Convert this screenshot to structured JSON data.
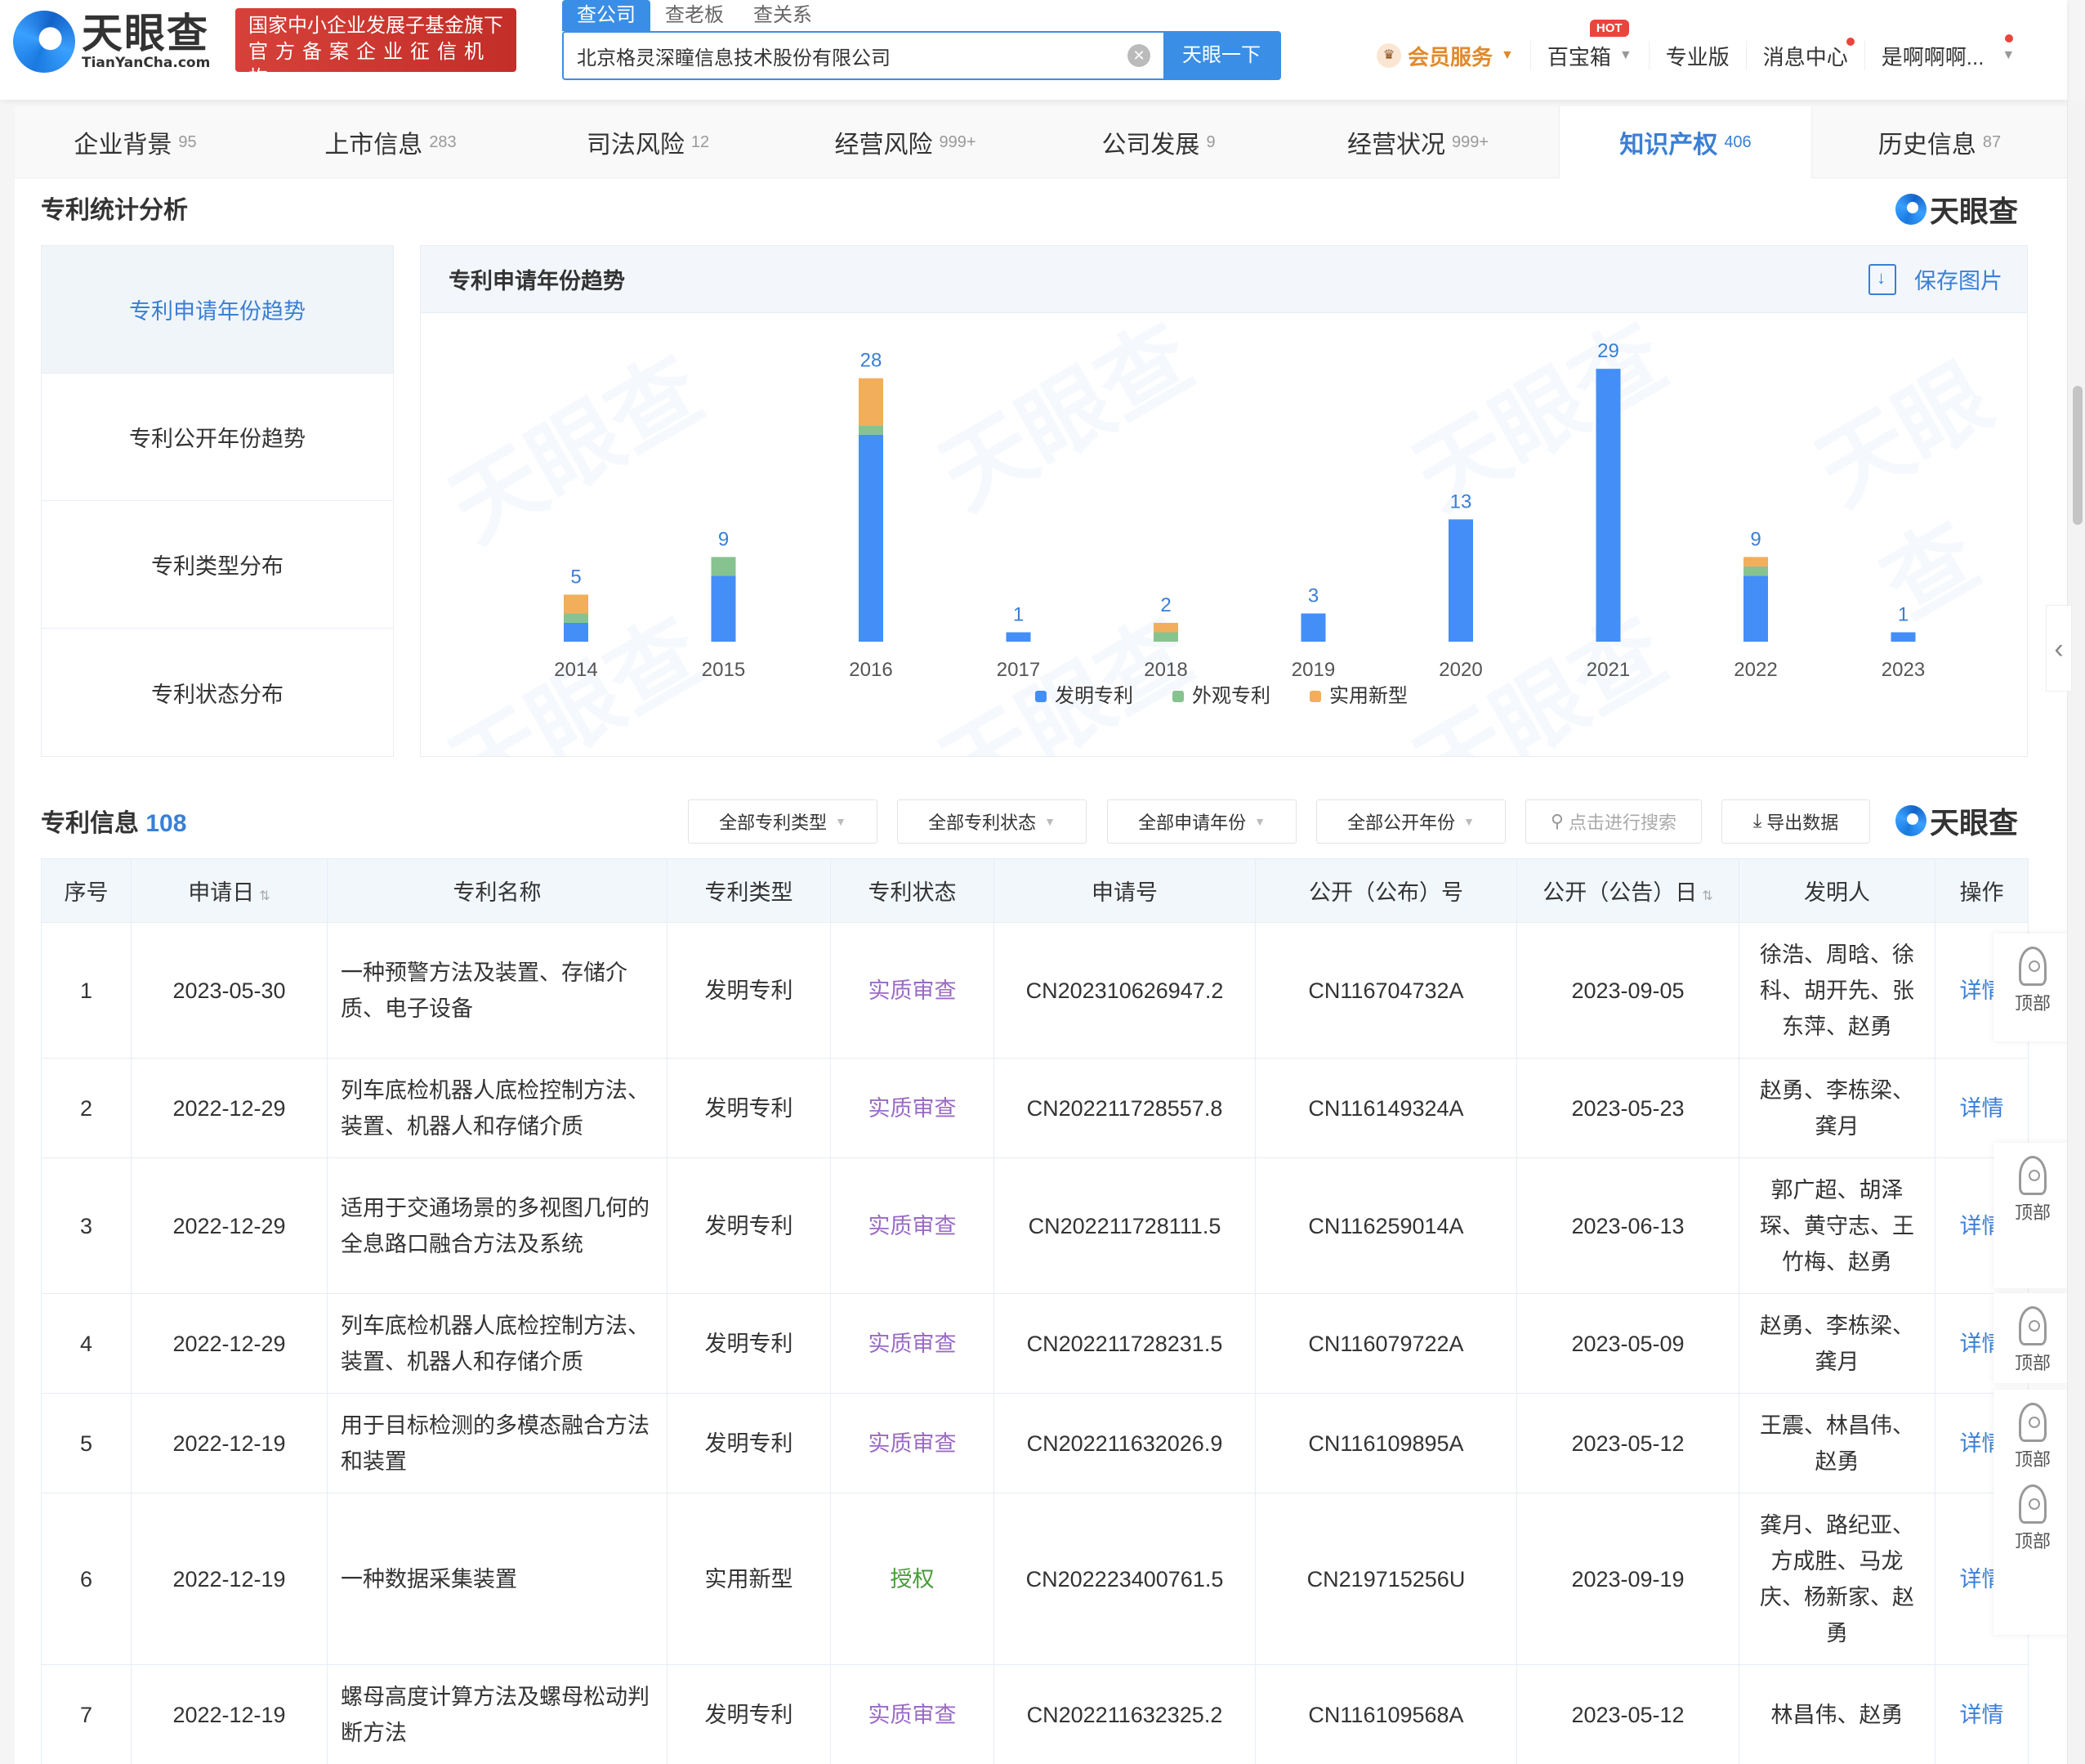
{
  "header": {
    "logo_cn": "天眼查",
    "logo_en": "TianYanCha.com",
    "badge_line1": "国家中小企业发展子基金旗下",
    "badge_line2": "官方备案企业征信机构",
    "search_tabs": [
      "查公司",
      "查老板",
      "查关系"
    ],
    "search_value": "北京格灵深瞳信息技术股份有限公司",
    "search_button": "天眼一下",
    "nav": {
      "vip": "会员服务",
      "toolbox": "百宝箱",
      "hot_badge": "HOT",
      "pro": "专业版",
      "messages": "消息中心",
      "user": "是啊啊啊..."
    }
  },
  "tabs": [
    {
      "label": "企业背景",
      "count": "95"
    },
    {
      "label": "上市信息",
      "count": "283"
    },
    {
      "label": "司法风险",
      "count": "12"
    },
    {
      "label": "经营风险",
      "count": "999+"
    },
    {
      "label": "公司发展",
      "count": "9"
    },
    {
      "label": "经营状况",
      "count": "999+"
    },
    {
      "label": "知识产权",
      "count": "406",
      "active": true
    },
    {
      "label": "历史信息",
      "count": "87"
    }
  ],
  "stats_section": {
    "title": "专利统计分析",
    "brand": "天眼查",
    "menu": [
      "专利申请年份趋势",
      "专利公开年份趋势",
      "专利类型分布",
      "专利状态分布"
    ],
    "active_menu": 0,
    "chart_title": "专利申请年份趋势",
    "save_label": "保存图片"
  },
  "chart_data": {
    "type": "bar",
    "stacked": true,
    "title": "专利申请年份趋势",
    "xlabel": "",
    "ylabel": "",
    "categories": [
      "2014",
      "2015",
      "2016",
      "2017",
      "2018",
      "2019",
      "2020",
      "2021",
      "2022",
      "2023"
    ],
    "series": [
      {
        "name": "发明专利",
        "color": "#448ef7",
        "values": [
          2,
          7,
          22,
          1,
          0,
          3,
          13,
          29,
          7,
          1
        ]
      },
      {
        "name": "外观专利",
        "color": "#87c38f",
        "values": [
          1,
          2,
          1,
          0,
          1,
          0,
          0,
          0,
          1,
          0
        ]
      },
      {
        "name": "实用新型",
        "color": "#f2ae5b",
        "values": [
          2,
          0,
          5,
          0,
          1,
          0,
          0,
          0,
          1,
          0
        ]
      }
    ],
    "totals": [
      5,
      9,
      28,
      1,
      2,
      3,
      13,
      29,
      9,
      1
    ],
    "ylim": [
      0,
      30
    ],
    "grid": false,
    "legend": "bottom-center"
  },
  "patent_section": {
    "title": "专利信息",
    "count": "108",
    "filters": [
      "全部专利类型",
      "全部专利状态",
      "全部申请年份",
      "全部公开年份"
    ],
    "search_placeholder": "点击进行搜索",
    "export_label": "导出数据",
    "brand": "天眼查"
  },
  "table": {
    "columns": [
      "序号",
      "申请日",
      "专利名称",
      "专利类型",
      "专利状态",
      "申请号",
      "公开（公布）号",
      "公开（公告）日",
      "发明人",
      "操作"
    ],
    "rows": [
      {
        "no": "1",
        "apply_date": "2023-05-30",
        "name": "一种预警方法及装置、存储介质、电子设备",
        "type": "发明专利",
        "status": "实质审查",
        "apply_no": "CN202310626947.2",
        "pub_no": "CN116704732A",
        "pub_date": "2023-09-05",
        "inventors": "徐浩、周晗、徐科、胡开先、张东萍、赵勇",
        "action": "详情"
      },
      {
        "no": "2",
        "apply_date": "2022-12-29",
        "name": "列车底检机器人底检控制方法、装置、机器人和存储介质",
        "type": "发明专利",
        "status": "实质审查",
        "apply_no": "CN202211728557.8",
        "pub_no": "CN116149324A",
        "pub_date": "2023-05-23",
        "inventors": "赵勇、李栋梁、龚月",
        "action": "详情"
      },
      {
        "no": "3",
        "apply_date": "2022-12-29",
        "name": "适用于交通场景的多视图几何的全息路口融合方法及系统",
        "type": "发明专利",
        "status": "实质审查",
        "apply_no": "CN202211728111.5",
        "pub_no": "CN116259014A",
        "pub_date": "2023-06-13",
        "inventors": "郭广超、胡泽琛、黄守志、王竹梅、赵勇",
        "action": "详情"
      },
      {
        "no": "4",
        "apply_date": "2022-12-29",
        "name": "列车底检机器人底检控制方法、装置、机器人和存储介质",
        "type": "发明专利",
        "status": "实质审查",
        "apply_no": "CN202211728231.5",
        "pub_no": "CN116079722A",
        "pub_date": "2023-05-09",
        "inventors": "赵勇、李栋梁、龚月",
        "action": "详情"
      },
      {
        "no": "5",
        "apply_date": "2022-12-19",
        "name": "用于目标检测的多模态融合方法和装置",
        "type": "发明专利",
        "status": "实质审查",
        "apply_no": "CN202211632026.9",
        "pub_no": "CN116109895A",
        "pub_date": "2023-05-12",
        "inventors": "王震、林昌伟、赵勇",
        "action": "详情"
      },
      {
        "no": "6",
        "apply_date": "2022-12-19",
        "name": "一种数据采集装置",
        "type": "实用新型",
        "status": "授权",
        "apply_no": "CN202223400761.5",
        "pub_no": "CN219715256U",
        "pub_date": "2023-09-19",
        "inventors": "龚月、路纪亚、方成胜、马龙庆、杨新家、赵勇",
        "action": "详情"
      },
      {
        "no": "7",
        "apply_date": "2022-12-19",
        "name": "螺母高度计算方法及螺母松动判断方法",
        "type": "发明专利",
        "status": "实质审查",
        "apply_no": "CN202211632325.2",
        "pub_no": "CN116109568A",
        "pub_date": "2023-05-12",
        "inventors": "林昌伟、赵勇",
        "action": "详情"
      }
    ]
  },
  "float_tools": {
    "top_label": "顶部"
  }
}
